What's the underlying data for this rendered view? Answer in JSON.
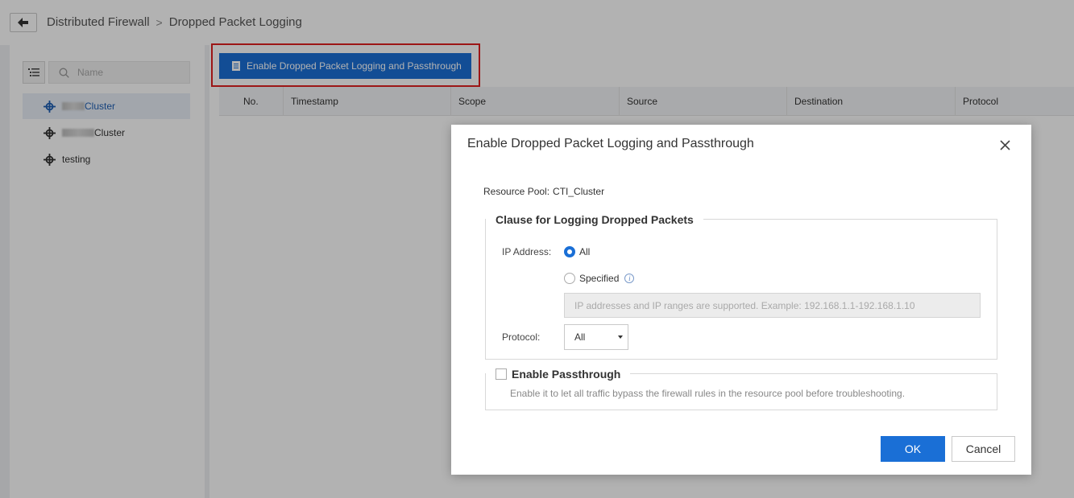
{
  "breadcrumb": {
    "parent": "Distributed Firewall",
    "separator": ">",
    "current": "Dropped Packet Logging"
  },
  "sidebar": {
    "search_placeholder": "Name",
    "items": [
      {
        "label": "Cluster",
        "active": true
      },
      {
        "label": "Cluster",
        "active": false
      },
      {
        "label": "testing",
        "active": false
      }
    ]
  },
  "toolbar": {
    "enable_button_label": "Enable Dropped Packet Logging and Passthrough"
  },
  "table": {
    "columns": [
      "No.",
      "Timestamp",
      "Scope",
      "Source",
      "Destination",
      "Protocol"
    ]
  },
  "dialog": {
    "title": "Enable Dropped Packet Logging and Passthrough",
    "resource_pool_label": "Resource Pool:",
    "resource_pool_value": "CTI_Cluster",
    "logging_clause": {
      "legend": "Clause for Logging Dropped Packets",
      "ip_address_label": "IP Address:",
      "option_all": "All",
      "option_specified": "Specified",
      "selected_option": "All",
      "ip_placeholder": "IP addresses and IP ranges are supported. Example: 192.168.1.1-192.168.1.10",
      "protocol_label": "Protocol:",
      "protocol_value": "All"
    },
    "passthrough": {
      "legend": "Enable Passthrough",
      "checked": false,
      "hint": "Enable it to let all traffic bypass the firewall rules in the resource pool before troubleshooting."
    },
    "ok_label": "OK",
    "cancel_label": "Cancel"
  },
  "colors": {
    "accent": "#1a6fd6",
    "highlight_border": "#e02020"
  }
}
